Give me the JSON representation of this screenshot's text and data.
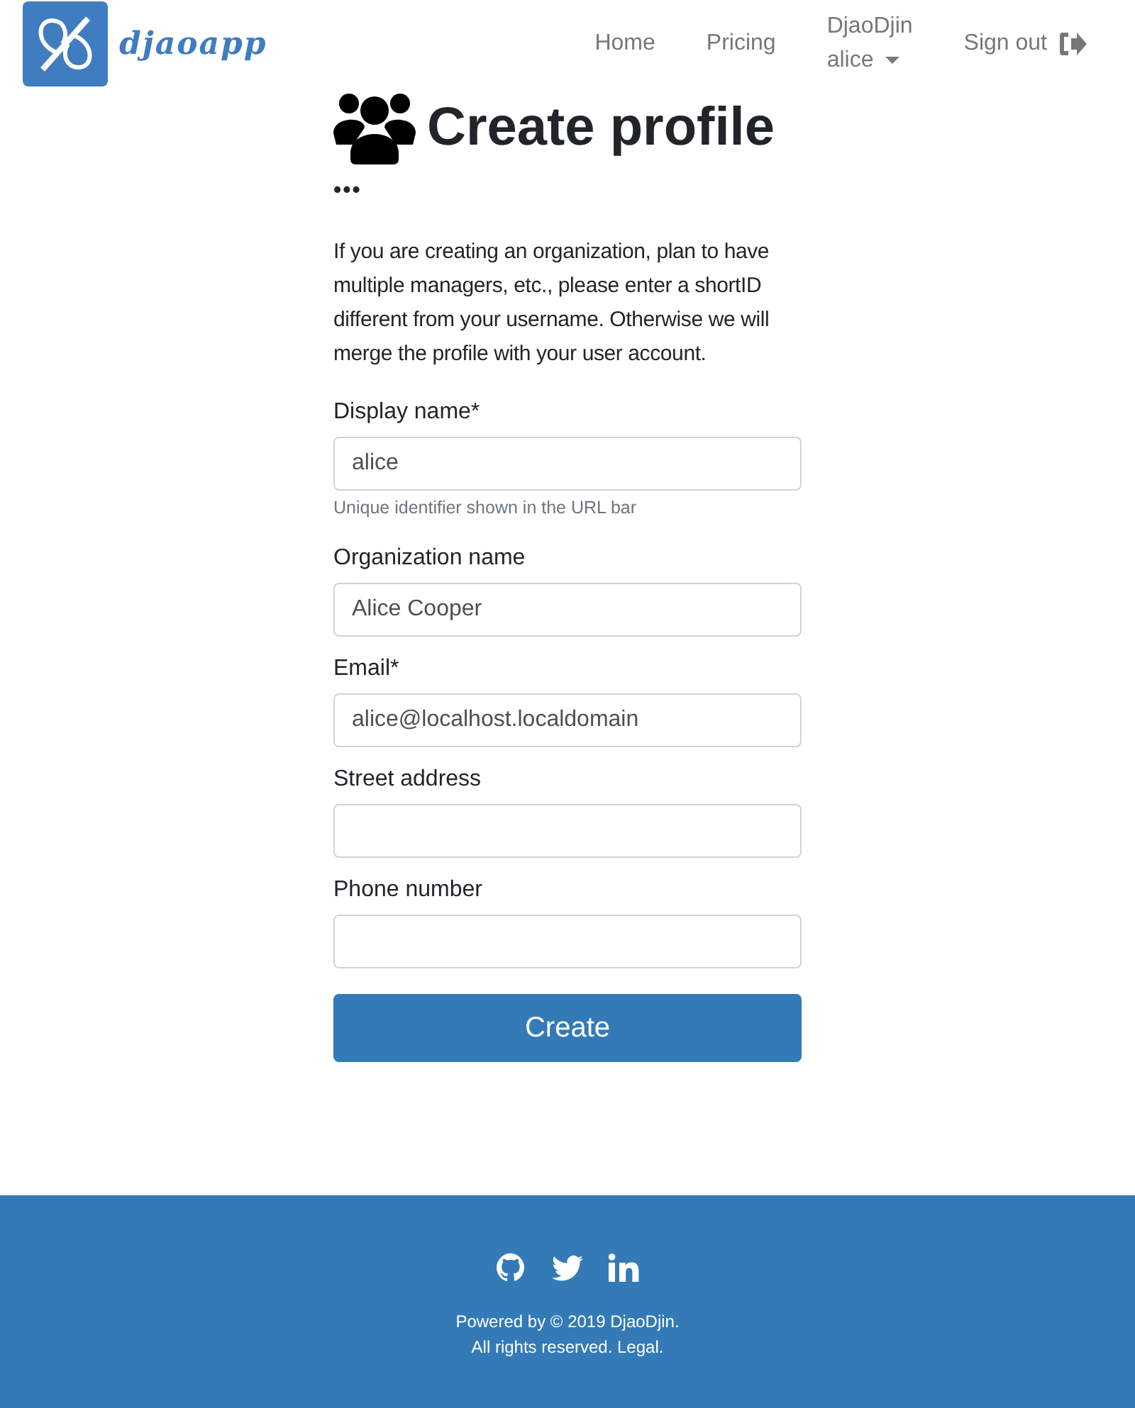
{
  "navbar": {
    "brand": "djaoapp",
    "links": [
      {
        "label": "Home",
        "kind": "link"
      },
      {
        "label": "Pricing",
        "kind": "link"
      },
      {
        "label": "DjaoDjin",
        "sublabel": "alice",
        "kind": "dropdown"
      },
      {
        "label": "Sign out",
        "kind": "signout"
      }
    ]
  },
  "page": {
    "title": "Create profile",
    "dots": "•••",
    "intro": "If you are creating an organization, plan to have multiple managers, etc., please enter a shortID different from your username. Otherwise we will merge the profile with your user account.",
    "fields": [
      {
        "label": "Display name*",
        "value": "alice",
        "help": "Unique identifier shown in the URL bar"
      },
      {
        "label": "Organization name",
        "value": "Alice Cooper"
      },
      {
        "label": "Email*",
        "value": "alice@localhost.localdomain"
      },
      {
        "label": "Street address"
      },
      {
        "label": "Phone number"
      }
    ],
    "submit": "Create"
  },
  "footer": {
    "line_1": "Powered by © 2019 DjaoDjin.",
    "line_2": "All rights reserved. Legal."
  }
}
